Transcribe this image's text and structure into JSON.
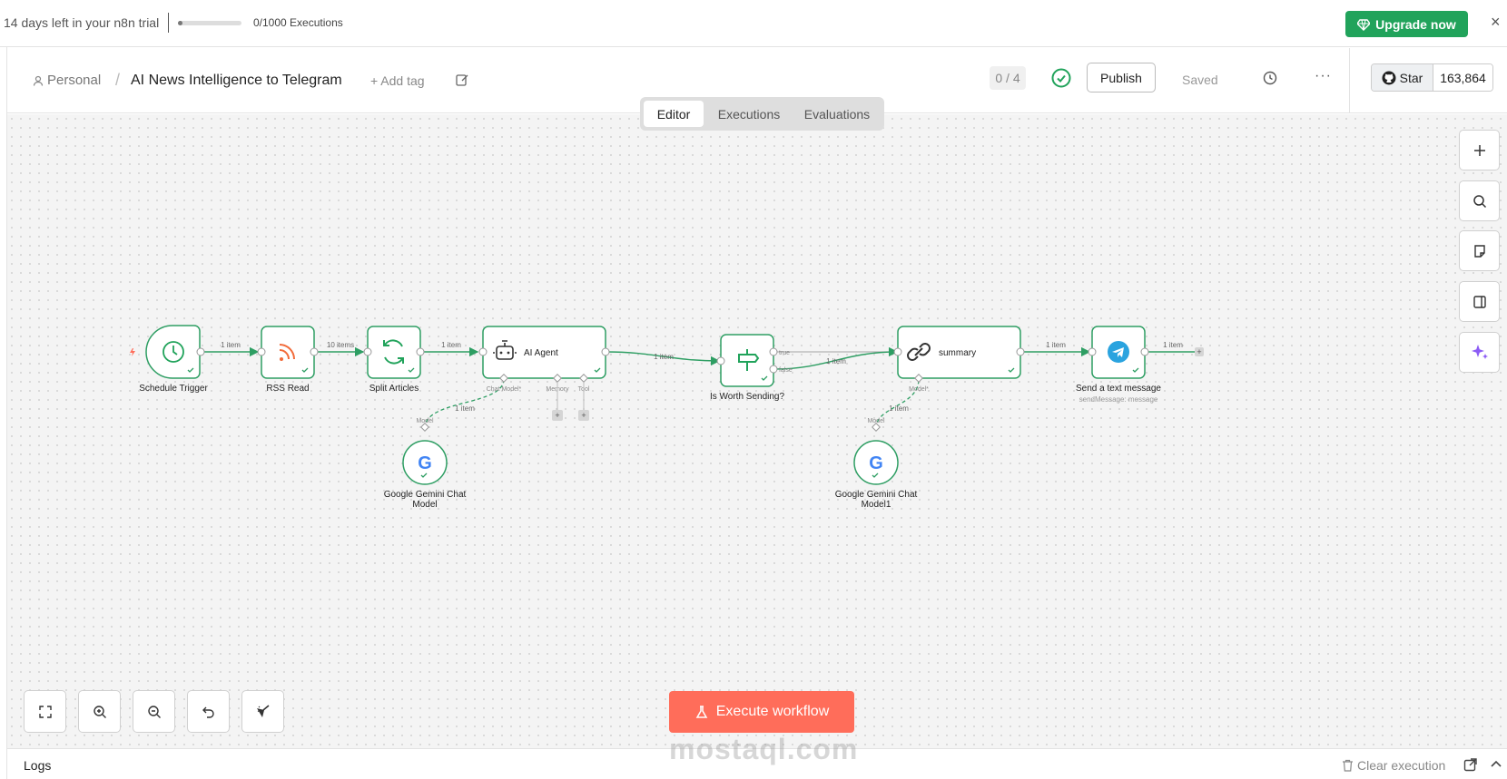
{
  "trial": {
    "text": "14 days left in your n8n trial",
    "executions": "0/1000 Executions",
    "executions_used_fraction": 0.0,
    "upgrade_label": "Upgrade now",
    "close": "×"
  },
  "header": {
    "workspace": "Personal",
    "separator": "/",
    "workflow_title": "AI News Intelligence to Telegram",
    "add_tag": "+ Add tag",
    "counter": "0 / 4",
    "publish": "Publish",
    "saved": "Saved",
    "more": "···",
    "github_star": "Star",
    "github_count": "163,864"
  },
  "tabs": [
    {
      "label": "Editor",
      "active": true
    },
    {
      "label": "Executions",
      "active": false
    },
    {
      "label": "Evaluations",
      "active": false
    }
  ],
  "nodes": {
    "schedule_trigger": {
      "label": "Schedule Trigger"
    },
    "rss_read": {
      "label": "RSS Read"
    },
    "split_articles": {
      "label": "Split Articles"
    },
    "ai_agent": {
      "label": "AI Agent",
      "ports": [
        "Chat Model*",
        "Memory",
        "Tool"
      ]
    },
    "is_worth_sending": {
      "label": "Is Worth Sending?",
      "outputs": [
        "true",
        "false"
      ]
    },
    "summary": {
      "label": "summary",
      "ports": [
        "Model*"
      ]
    },
    "send_message": {
      "label": "Send a text message",
      "subtitle": "sendMessage: message"
    },
    "gemini_1": {
      "label_line1": "Google Gemini Chat",
      "label_line2": "Model",
      "port": "Model"
    },
    "gemini_2": {
      "label_line1": "Google Gemini Chat",
      "label_line2": "Model1",
      "port": "Model"
    }
  },
  "connections": {
    "schedule_to_rss": "1 item",
    "rss_to_split": "10 items",
    "split_to_agent": "1 item",
    "agent_to_if": "1 item",
    "if_to_summary": "1 item",
    "summary_to_send": "1 item",
    "send_out": "1 item",
    "gemini1_to_agent": "1 item",
    "gemini2_to_summary": "1 item"
  },
  "execute_button": "Execute workflow",
  "watermark": "mostaql.com",
  "logs": {
    "label": "Logs",
    "clear_execution": "Clear execution"
  },
  "colors": {
    "accent_green": "#21a35b",
    "node_success": "#2ea36b",
    "execute": "#ff6d5a"
  }
}
